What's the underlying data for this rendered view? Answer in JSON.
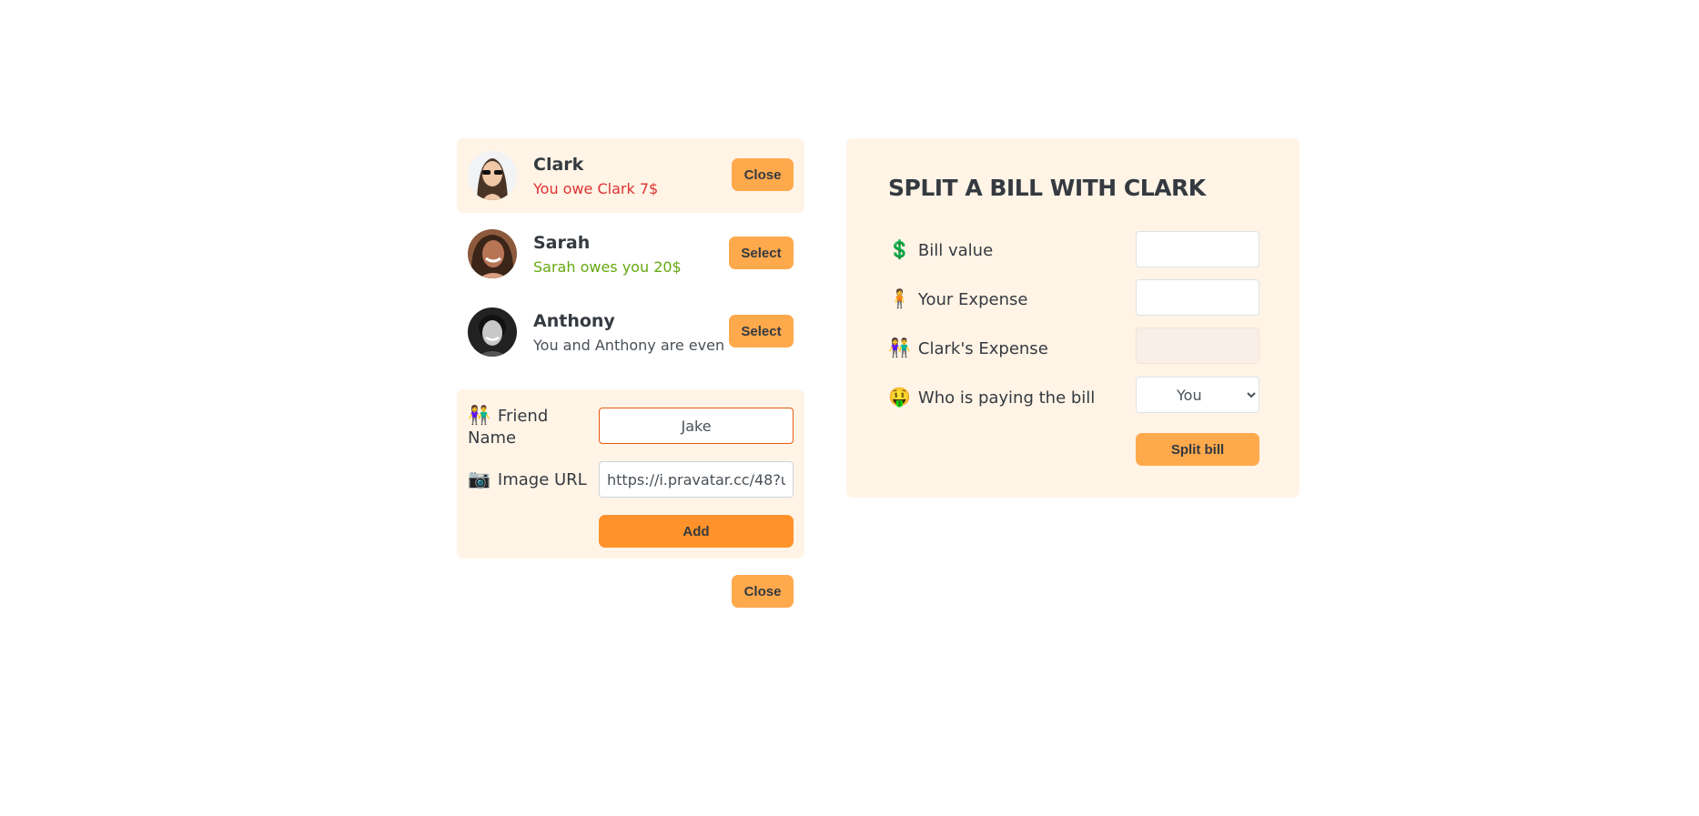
{
  "friends": [
    {
      "name": "Clark",
      "status": "You owe Clark 7$",
      "button": "Close"
    },
    {
      "name": "Sarah",
      "status": "Sarah owes you 20$",
      "button": "Select"
    },
    {
      "name": "Anthony",
      "status": "You and Anthony are even",
      "button": "Select"
    }
  ],
  "add_friend": {
    "name_label": "Friend Name",
    "name_value": "Jake",
    "image_label": "Image URL",
    "image_value": "https://i.pravatar.cc/48?u=",
    "add_button": "Add",
    "close_button": "Close"
  },
  "split_bill": {
    "title": "SPLIT A BILL WITH CLARK",
    "bill_value_label": "Bill value",
    "your_expense_label": "Your Expense",
    "friend_expense_label": "Clark's Expense",
    "payer_label": "Who is paying the bill",
    "payer_selected": "You",
    "split_button": "Split bill"
  },
  "colors": {
    "panel_bg": "#fff4e6",
    "button": "#ffa94d",
    "button_strong": "#ff922b",
    "owe": "#e03131",
    "owed": "#66a80f"
  },
  "icons": {
    "friend_name": "people-icon",
    "image_url": "camera-icon",
    "bill_value": "dollar-icon",
    "your_expense": "person-icon",
    "friend_expense": "people-icon",
    "payer": "money-face-icon"
  }
}
